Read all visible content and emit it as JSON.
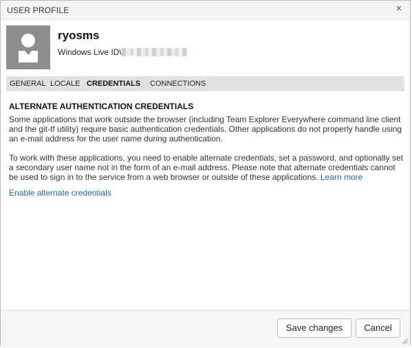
{
  "dialog": {
    "title": "USER PROFILE",
    "close_icon": "×"
  },
  "profile": {
    "username": "ryosms",
    "live_id_label": "Windows Live ID\\"
  },
  "tabs": [
    {
      "label": "GENERAL",
      "active": false
    },
    {
      "label": "LOCALE",
      "active": false
    },
    {
      "label": "CREDENTIALS",
      "active": true
    },
    {
      "label": "CONNECTIONS",
      "active": false
    }
  ],
  "credentials": {
    "heading": "ALTERNATE AUTHENTICATION CREDENTIALS",
    "paragraph1": "Some applications that work outside the browser (including Team Explorer Everywhere command line client and the git-tf utility) require basic authentication credentials. Other applications do not properly handle using an e-mail address for the user name during authentication.",
    "paragraph2": "To work with these applications, you need to enable alternate credentials, set a password, and optionally set a secondary user name not in the form of an e-mail address. Please note that alternate credentials cannot be used to sign in to the service from a web browser or outside of these applications.",
    "learn_more": "Learn more",
    "enable_link": "Enable alternate credentials"
  },
  "footer": {
    "save_label": "Save changes",
    "cancel_label": "Cancel"
  },
  "colors": {
    "link": "#1e66b0",
    "tab_bar": "#e2e2e2",
    "avatar_bg": "#8e8e8e"
  },
  "icons": [
    "close-icon",
    "user-avatar-icon",
    "resize-grip-icon"
  ]
}
